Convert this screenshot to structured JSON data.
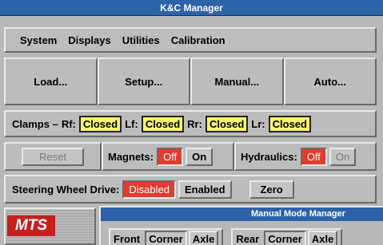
{
  "window": {
    "title": "K&C Manager"
  },
  "menu": [
    "System",
    "Displays",
    "Utilities",
    "Calibration"
  ],
  "actions": [
    "Load...",
    "Setup...",
    "Manual...",
    "Auto..."
  ],
  "clamps": {
    "label": "Clamps –",
    "items": [
      {
        "label": "Rf:",
        "state": "Closed"
      },
      {
        "label": "Lf:",
        "state": "Closed"
      },
      {
        "label": "Rr:",
        "state": "Closed"
      },
      {
        "label": "Lr:",
        "state": "Closed"
      }
    ]
  },
  "controls": {
    "reset_label": "Reset",
    "magnets": {
      "label": "Magnets:",
      "off": "Off",
      "on": "On"
    },
    "hydraulics": {
      "label": "Hydraulics:",
      "off": "Off",
      "on": "On"
    }
  },
  "steering": {
    "label": "Steering Wheel Drive:",
    "disabled": "Disabled",
    "enabled": "Enabled",
    "zero": "Zero"
  },
  "logo": {
    "text": "MTS"
  },
  "manual_mode": {
    "title": "Manual Mode Manager",
    "front": {
      "label": "Front",
      "corner": "Corner",
      "axle": "Axle"
    },
    "rear": {
      "label": "Rear",
      "corner": "Corner",
      "axle": "Axle"
    }
  },
  "colors": {
    "title_bar": "#2c62a8",
    "closed_bg": "#f5f56a",
    "off_active": "#e23b2e"
  }
}
